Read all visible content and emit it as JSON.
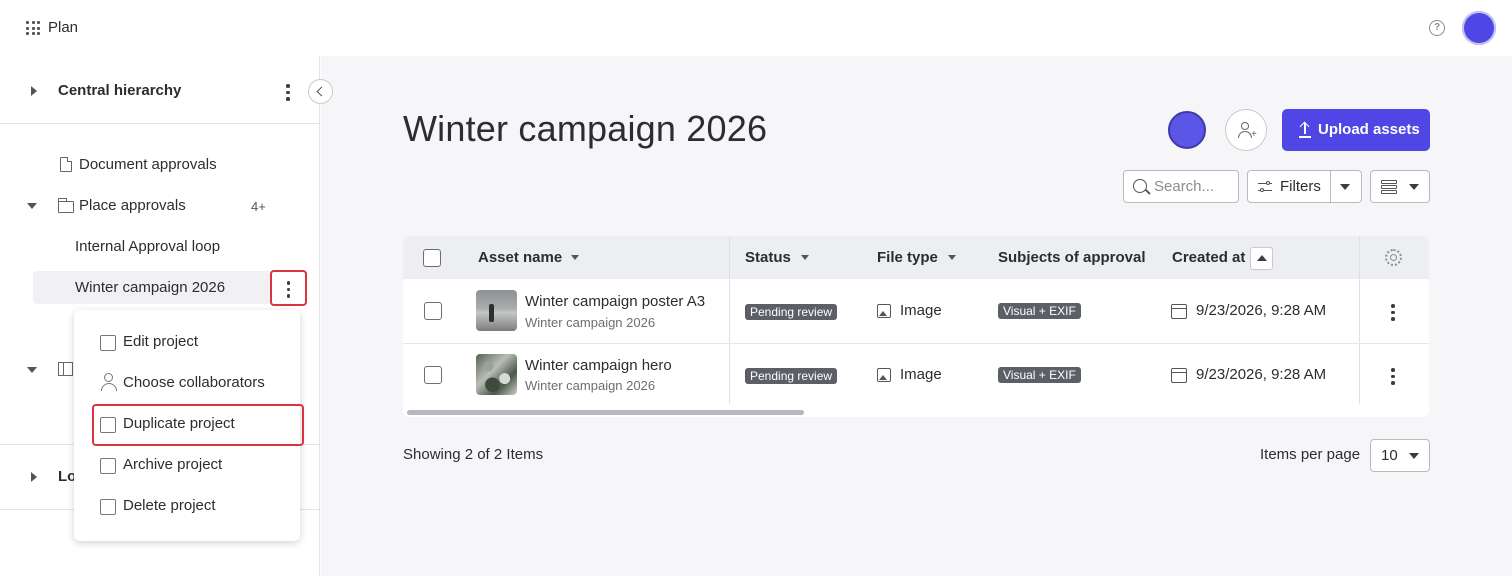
{
  "app": {
    "name": "Plan",
    "help_icon": "help-circle-icon",
    "avatar_color": "#4f46e5"
  },
  "sidebar": {
    "sections": [
      {
        "label": "Central hierarchy",
        "expanded": false
      },
      {
        "label": "Lo",
        "expanded": false
      }
    ],
    "items": [
      {
        "label": "Document approvals",
        "icon": "document-icon"
      },
      {
        "label": "Place approvals",
        "icon": "folder-icon",
        "count": "4+",
        "expanded": true
      },
      {
        "label": "Internal Approval loop"
      },
      {
        "label": "Winter campaign 2026",
        "selected": true
      }
    ]
  },
  "context_menu": {
    "items": [
      {
        "label": "Edit project",
        "icon": "edit-icon"
      },
      {
        "label": "Choose collaborators",
        "icon": "person-icon"
      },
      {
        "label": "Duplicate project",
        "icon": "duplicate-icon",
        "highlighted": true
      },
      {
        "label": "Archive project",
        "icon": "archive-icon"
      },
      {
        "label": "Delete project",
        "icon": "trash-icon"
      }
    ]
  },
  "main": {
    "title": "Winter campaign 2026",
    "upload_label": "Upload assets",
    "search_placeholder": "Search...",
    "filters_label": "Filters",
    "accent_color": "#4f46e5",
    "table": {
      "columns": [
        "Asset name",
        "Status",
        "File type",
        "Subjects of approval",
        "Created at"
      ],
      "rows": [
        {
          "name": "Winter campaign poster A3",
          "project": "Winter campaign 2026",
          "status": "Pending review",
          "file_type": "Image",
          "subjects": "Visual + EXIF",
          "created_at": "9/23/2026, 9:28 AM"
        },
        {
          "name": "Winter campaign hero",
          "project": "Winter campaign 2026",
          "status": "Pending review",
          "file_type": "Image",
          "subjects": "Visual + EXIF",
          "created_at": "9/23/2026, 9:28 AM"
        }
      ]
    },
    "showing_text": "Showing 2 of 2 Items",
    "items_per_page_label": "Items per page",
    "items_per_page_value": "10"
  }
}
